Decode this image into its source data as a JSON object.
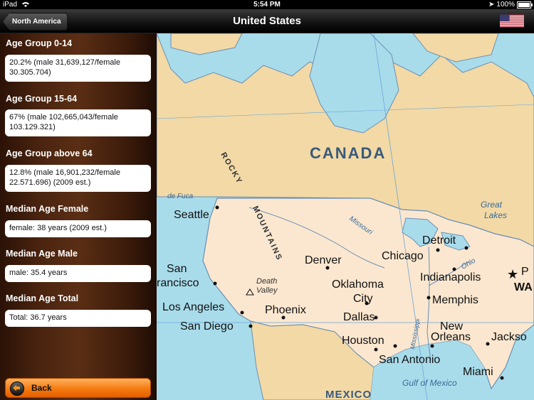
{
  "status": {
    "device": "iPad",
    "time": "5:54 PM",
    "battery": "100%"
  },
  "nav": {
    "back_label": "North America",
    "title": "United States"
  },
  "sections": [
    {
      "label": "Age Group 0-14",
      "value": "20.2% (male 31,639,127/female 30.305.704)"
    },
    {
      "label": "Age Group 15-64",
      "value": "67% (male 102,665,043/female 103.129.321)"
    },
    {
      "label": "Age Group above 64",
      "value": "12.8% (male 16,901,232/female 22.571.696) (2009 est.)"
    },
    {
      "label": "Median Age Female",
      "value": "female: 38 years (2009 est.)"
    },
    {
      "label": "Median Age Male",
      "value": "male: 35.4 years"
    },
    {
      "label": "Median Age Total",
      "value": "Total: 36.7 years"
    }
  ],
  "back_button": {
    "label": "Back"
  },
  "map": {
    "labels": {
      "canada": "CANADA",
      "rocky": "ROCKY",
      "mountains": "MOUNTAINS",
      "mexico": "MEXICO",
      "great_lakes_1": "Great",
      "great_lakes_2": "Lakes",
      "missouri": "Missouri",
      "ohio": "Ohio",
      "mississippi": "Mississippi",
      "death_valley_1": "Death",
      "death_valley_2": "Valley",
      "gulf": "Gulf of Mexico",
      "de_fuca": "de Fuca"
    },
    "cities": {
      "seattle": "Seattle",
      "san_1": "San",
      "francisco": "rancisco",
      "los_angeles": "Los Angeles",
      "san_diego": "San Diego",
      "phoenix": "Phoenix",
      "denver": "Denver",
      "oklahoma_1": "Oklahoma",
      "oklahoma_2": "City",
      "dallas": "Dallas",
      "houston": "Houston",
      "san_antonio": "San Antonio",
      "chicago": "Chicago",
      "detroit": "Detroit",
      "indianapolis": "Indianapolis",
      "memphis": "Memphis",
      "new_orleans_1": "New",
      "new_orleans_2": "Orleans",
      "jackson": "Jackso",
      "miami": "Miami",
      "wa": "WA",
      "p": "P"
    }
  },
  "colors": {
    "ocean": "#a9dcea",
    "land_us": "#fbe7cf",
    "land_other": "#f2d9a6",
    "back_orange": "#f47a10"
  }
}
